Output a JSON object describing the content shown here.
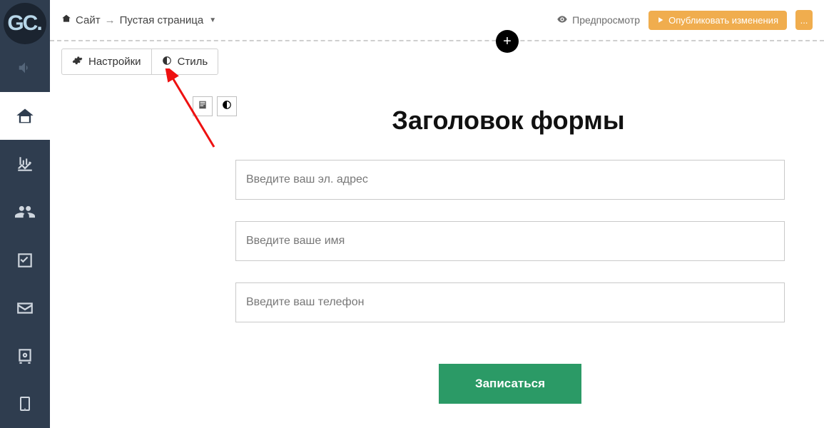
{
  "logo": {
    "text": "GC"
  },
  "breadcrumb": {
    "site_label": "Сайт",
    "page_label": "Пустая страница"
  },
  "topbar": {
    "preview_label": "Предпросмотр",
    "publish_label": "Опубликовать изменения",
    "publish_more": "..."
  },
  "section_toolbar": {
    "settings_label": "Настройки",
    "style_label": "Стиль"
  },
  "form": {
    "title": "Заголовок формы",
    "fields": {
      "email_placeholder": "Введите ваш эл. адрес",
      "name_placeholder": "Введите ваше имя",
      "phone_placeholder": "Введите ваш телефон"
    },
    "submit_label": "Записаться"
  },
  "colors": {
    "sidebar_bg": "#2f3d4f",
    "publish_bg": "#f0ad4e",
    "submit_bg": "#2b9a66"
  }
}
